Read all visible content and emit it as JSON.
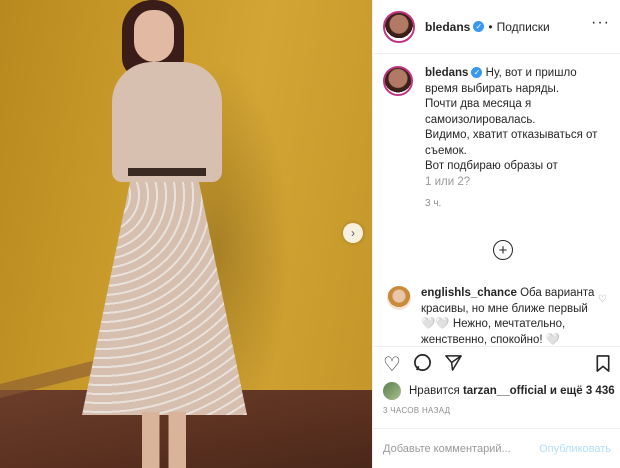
{
  "post": {
    "next_icon": "chevron-right-icon"
  },
  "header": {
    "username": "bledans",
    "separator": "•",
    "follow_label": "Подписки",
    "more_icon": "ellipsis-icon"
  },
  "caption": {
    "username": "bledans",
    "lines": [
      "Ну, вот и пришло время выбирать наряды.",
      "Почти два месяца я самоизолировалась.",
      "Видимо, хватит отказываться от съемок.",
      "Вот подбираю образы от",
      "1 или 2?"
    ],
    "time": "3 ч."
  },
  "comment": {
    "username": "englishls_chance",
    "text": "Оба варианта красивы, но мне ближе первый 🤍🤍 Нежно, мечтательно, женственно, спокойно! 🤍"
  },
  "actions": {
    "like_icon": "heart-icon",
    "comment_icon": "comment-icon",
    "share_icon": "paper-plane-icon",
    "save_icon": "bookmark-icon"
  },
  "likes": {
    "prefix": "Нравится",
    "user": "tarzan__official",
    "suffix": "и ещё 3 436"
  },
  "posted": "3 ЧАСОВ НАЗАД",
  "add_comment": {
    "placeholder": "Добавьте комментарий...",
    "publish_label": "Опубликовать"
  },
  "colors": {
    "verified": "#3897f0",
    "publish": "#b2dffc",
    "wall": "#c99b2b"
  }
}
